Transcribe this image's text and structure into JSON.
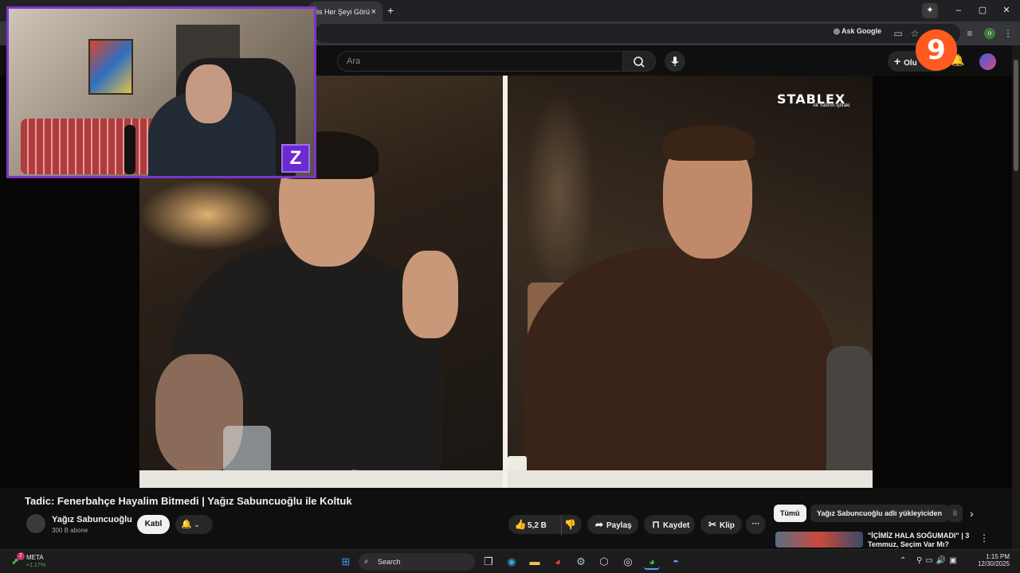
{
  "browser": {
    "tab_title": "lis Her Şeyi Görü",
    "tab_close": "×",
    "new_tab": "+",
    "ask_google": "Ask Google",
    "profile_initial": "o",
    "window_min": "–",
    "window_max": "▢",
    "window_close": "✕"
  },
  "youtube": {
    "search_placeholder": "Ara",
    "create_label": "Olu",
    "brand": "STABLEX",
    "brand_sub": "Ak Yatırım İştiraki",
    "video_title": "Tadic: Fenerbahçe Hayalim Bitmedi | Yağız Sabuncuoğlu ile Koltuk",
    "channel_name": "Yağız Sabuncuoğlu",
    "subscribers": "300 B abone",
    "join_label": "Katıl",
    "likes": "5,2 B",
    "share_label": "Paylaş",
    "save_label": "Kaydet",
    "clip_label": "Klip",
    "more_label": "···",
    "chips": [
      "Tümü",
      "Yağız Sabuncuoğlu adlı yükleyiciden",
      "İl"
    ],
    "rec_title": "\"İÇİMİZ HALA SOĞUMADI\" | 3 Temmuz, Seçim Var Mı?"
  },
  "overlay": {
    "badge": "9",
    "cam_logo": "Z"
  },
  "taskbar": {
    "stock_name": "META",
    "stock_change": "+1.17%",
    "stock_badge": "2",
    "search_label": "Search",
    "time": "1:15 PM",
    "date": "12/30/2025"
  }
}
